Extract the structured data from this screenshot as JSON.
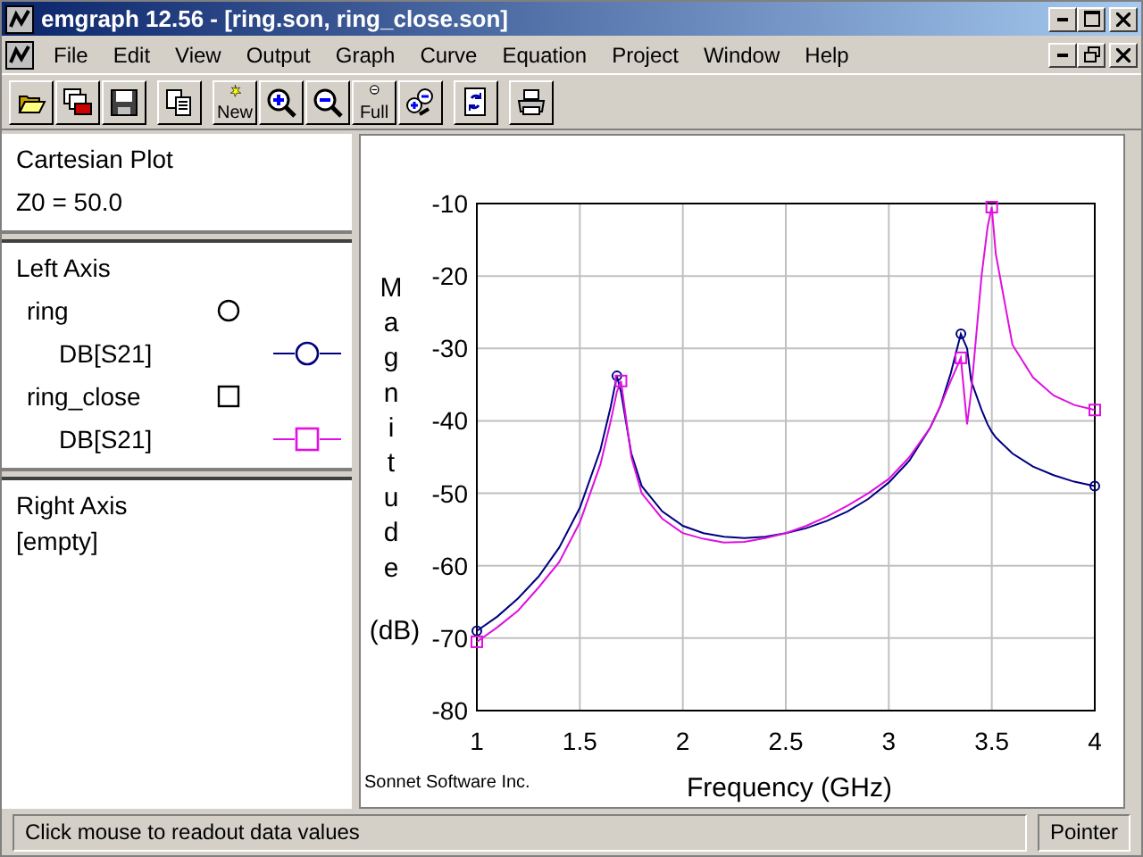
{
  "window": {
    "title": "emgraph 12.56 - [ring.son, ring_close.son]"
  },
  "menu": [
    "File",
    "Edit",
    "View",
    "Output",
    "Graph",
    "Curve",
    "Equation",
    "Project",
    "Window",
    "Help"
  ],
  "toolbar": [
    [
      {
        "kind": "open"
      },
      {
        "kind": "save-all"
      },
      {
        "kind": "save"
      }
    ],
    [
      {
        "kind": "copy"
      }
    ],
    [
      {
        "kind": "new",
        "label": "New"
      },
      {
        "kind": "zoom-in"
      },
      {
        "kind": "zoom-out"
      },
      {
        "kind": "full",
        "label": "Full"
      },
      {
        "kind": "zoom-both"
      }
    ],
    [
      {
        "kind": "refresh"
      }
    ],
    [
      {
        "kind": "print"
      }
    ]
  ],
  "info_panel": {
    "title": "Cartesian Plot",
    "z0": "Z0 = 50.0"
  },
  "left_axis": {
    "title": "Left Axis",
    "curves": [
      {
        "name": "ring",
        "kind": "circle",
        "params": [
          {
            "label": "DB[S21]",
            "color": "#000080"
          }
        ]
      },
      {
        "name": "ring_close",
        "kind": "square",
        "params": [
          {
            "label": "DB[S21]",
            "color": "#e010e0"
          }
        ]
      }
    ]
  },
  "right_axis": {
    "title": "Right Axis",
    "items": [
      "[empty]"
    ]
  },
  "plot": {
    "credit": "Sonnet Software Inc.",
    "chart_data": {
      "type": "line",
      "xlabel": "Frequency (GHz)",
      "ylabel": "Magnitude (dB)",
      "grid": true,
      "x": [
        1,
        1.1,
        1.2,
        1.3,
        1.4,
        1.5,
        1.6,
        1.65,
        1.68,
        1.7,
        1.75,
        1.8,
        1.9,
        2.0,
        2.1,
        2.2,
        2.3,
        2.4,
        2.5,
        2.6,
        2.7,
        2.8,
        2.9,
        3.0,
        3.1,
        3.2,
        3.25,
        3.3,
        3.35,
        3.38,
        3.4,
        3.45,
        3.48,
        3.5,
        3.52,
        3.6,
        3.7,
        3.8,
        3.9,
        4.0
      ],
      "series": [
        {
          "color": "#000080",
          "values": [
            -69,
            -67,
            -64.5,
            -61.5,
            -57.5,
            -52,
            -44,
            -38,
            -33.8,
            -36,
            -44.5,
            -49,
            -52.5,
            -54.5,
            -55.5,
            -56,
            -56.2,
            -56,
            -55.5,
            -54.8,
            -53.8,
            -52.5,
            -50.8,
            -48.5,
            -45.5,
            -41,
            -38,
            -33.5,
            -28,
            -30,
            -34.5,
            -38.5,
            -40.5,
            -41.5,
            -42.3,
            -44.5,
            -46.3,
            -47.5,
            -48.4,
            -49
          ]
        },
        {
          "color": "#e010e0",
          "values": [
            -70.5,
            -68.5,
            -66.2,
            -63,
            -59.5,
            -54,
            -46,
            -40,
            -36,
            -34.5,
            -45,
            -50,
            -53.5,
            -55.5,
            -56.3,
            -56.8,
            -56.7,
            -56.2,
            -55.5,
            -54.5,
            -53.2,
            -51.7,
            -50,
            -48,
            -45,
            -41,
            -38,
            -34.5,
            -31.3,
            -40.5,
            -36,
            -20,
            -13.2,
            -10.5,
            -17,
            -29.5,
            -34,
            -36.5,
            -37.8,
            -38.5
          ]
        }
      ],
      "xlim": [
        1,
        4
      ],
      "ylim": [
        -80,
        -10
      ],
      "xticks": [
        1,
        {
          "value": 1.5,
          "label": "1.5"
        },
        2,
        {
          "value": 2.5,
          "label": "2.5"
        },
        3,
        {
          "value": 3.5,
          "label": "3.5"
        },
        4
      ],
      "yticks": [
        -10,
        -20,
        -30,
        -40,
        -50,
        -60,
        -70,
        -80
      ]
    }
  },
  "status_bar": {
    "message": "Click mouse to readout data values",
    "mode": "Pointer"
  }
}
